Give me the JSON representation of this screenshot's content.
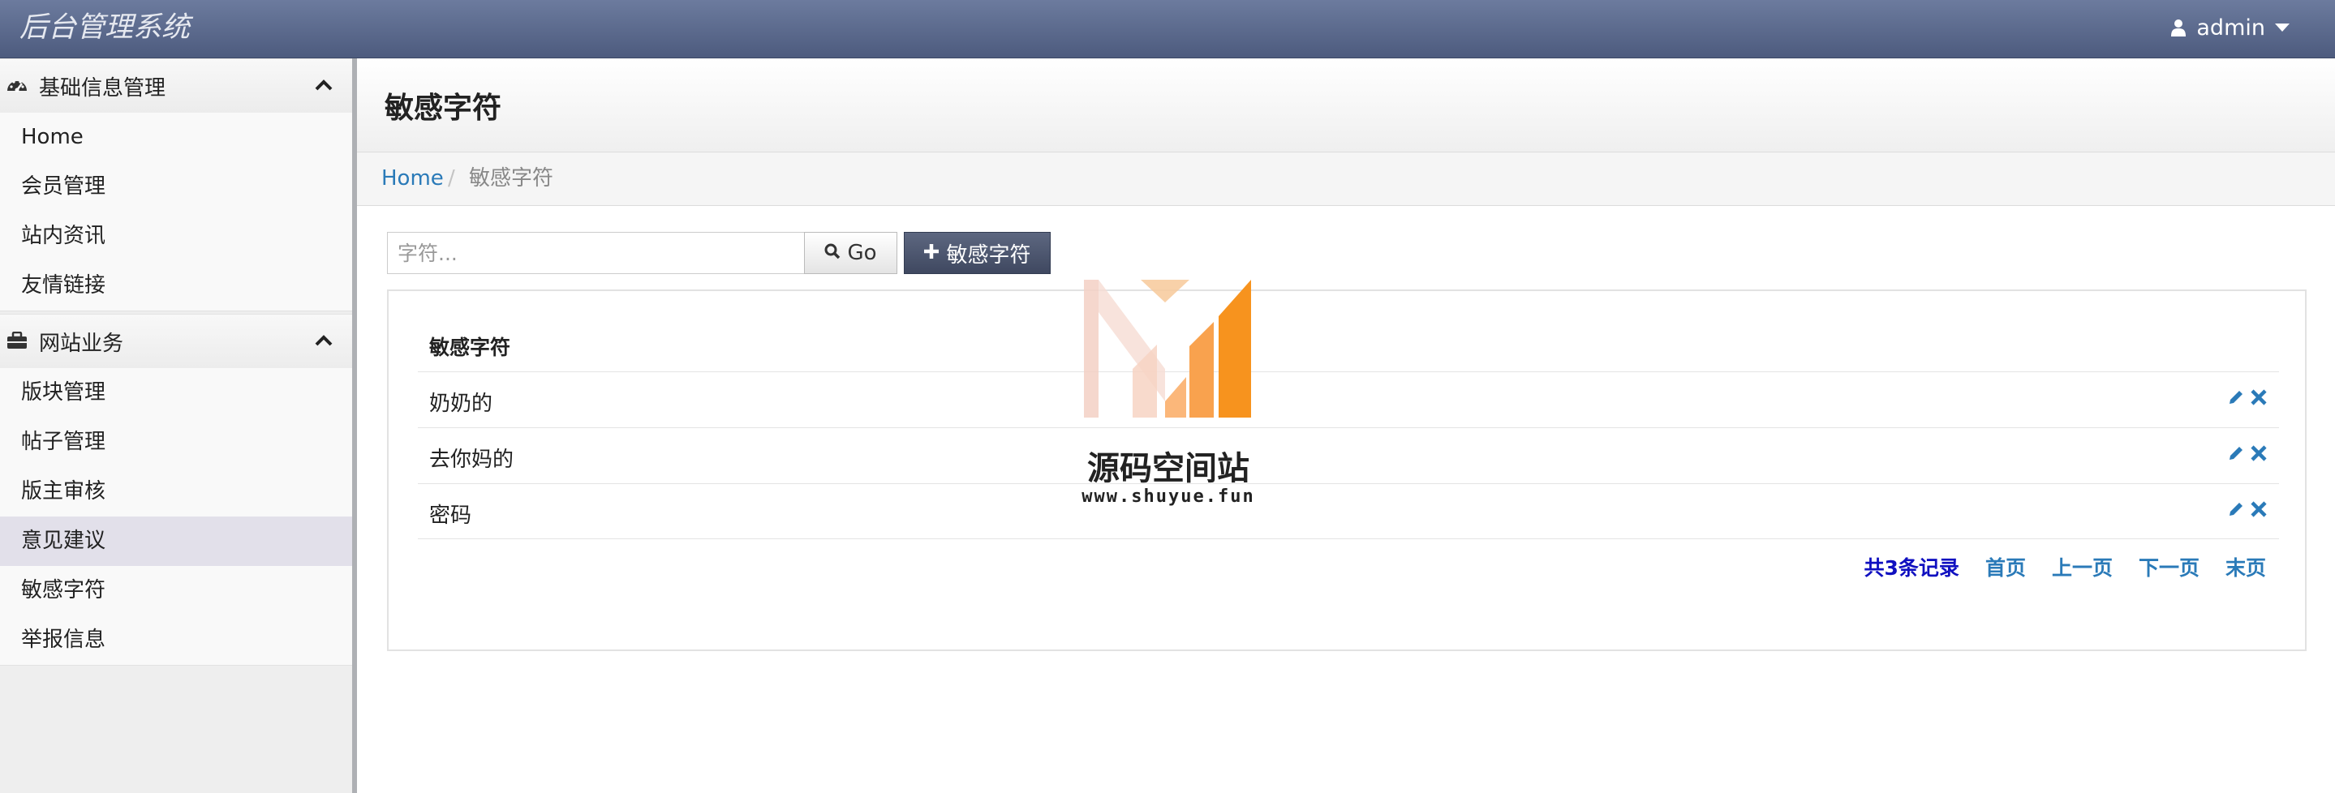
{
  "app": {
    "title": "后台管理系统",
    "user": "admin"
  },
  "sidebar": {
    "groups": [
      {
        "label": "基础信息管理",
        "icon": "dashboard-icon",
        "items": [
          {
            "label": "Home"
          },
          {
            "label": "会员管理"
          },
          {
            "label": "站内资讯"
          },
          {
            "label": "友情链接"
          }
        ]
      },
      {
        "label": "网站业务",
        "icon": "briefcase-icon",
        "items": [
          {
            "label": "版块管理"
          },
          {
            "label": "帖子管理"
          },
          {
            "label": "版主审核"
          },
          {
            "label": "意见建议",
            "active": true
          },
          {
            "label": "敏感字符"
          },
          {
            "label": "举报信息"
          }
        ]
      }
    ]
  },
  "page": {
    "title": "敏感字符",
    "breadcrumb": {
      "home": "Home",
      "separator": "/",
      "current": "敏感字符"
    }
  },
  "toolbar": {
    "search_placeholder": "字符...",
    "search_value": "",
    "go_label": "Go",
    "add_label": "敏感字符"
  },
  "table": {
    "header": "敏感字符",
    "rows": [
      {
        "word": "奶奶的"
      },
      {
        "word": "去你妈的"
      },
      {
        "word": "密码"
      }
    ]
  },
  "pagination": {
    "total": "共3条记录",
    "first": "首页",
    "prev": "上一页",
    "next": "下一页",
    "last": "末页"
  },
  "watermark": {
    "text": "源码空间站",
    "url": "www.shuyue.fun"
  },
  "colors": {
    "navbar": "#5d6b8e",
    "link": "#2a7ab8",
    "total": "#1010c0",
    "add_button": "#4a536b",
    "watermark_orange": "#f7931e"
  }
}
